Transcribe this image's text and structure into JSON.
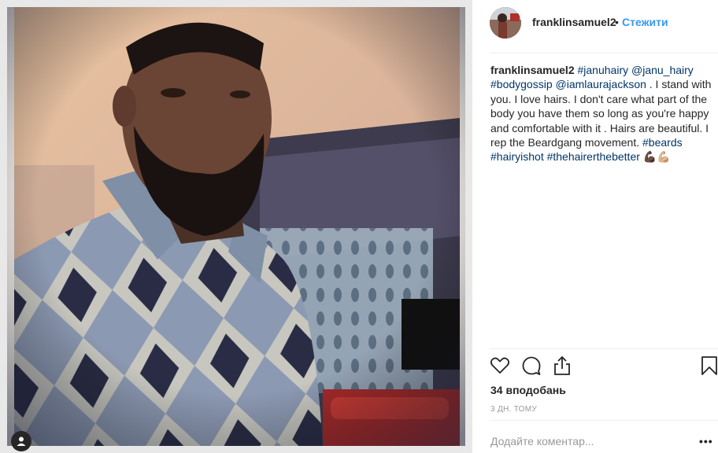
{
  "post": {
    "username": "franklinsamuel2",
    "separator": "•",
    "follow_label": "Стежити",
    "caption": {
      "username": "franklinsamuel2",
      "parts": [
        {
          "t": "#januhairy",
          "h": true
        },
        {
          "t": " "
        },
        {
          "t": "@janu_hairy",
          "h": true
        },
        {
          "t": " "
        },
        {
          "t": "#bodygossip",
          "h": true
        },
        {
          "t": " "
        },
        {
          "t": "@iamlaurajackson",
          "h": true
        },
        {
          "t": " . I stand with you. I love hairs. I don't care what part of the body you have them so long as you're happy and comfortable with it . Hairs are beautiful. I rep the Beardgang movement. "
        },
        {
          "t": "#beards",
          "h": true
        },
        {
          "t": " "
        },
        {
          "t": "#hairyishot",
          "h": true
        },
        {
          "t": " "
        },
        {
          "t": "#thehairerthebetter",
          "h": true
        },
        {
          "t": " 💪🏿💪🏼"
        }
      ]
    },
    "likes": "34 вподобань",
    "time": "3 ДН. ТОМУ",
    "comment_placeholder": "Додайте коментар...",
    "more_label": "•••"
  },
  "icons": {
    "tag": "user-tag-icon",
    "like": "heart-icon",
    "comment": "comment-icon",
    "share": "share-icon",
    "save": "bookmark-icon"
  },
  "colors": {
    "link": "#3897f0",
    "hashtag": "#003569",
    "text": "#262626",
    "muted": "#999999"
  }
}
